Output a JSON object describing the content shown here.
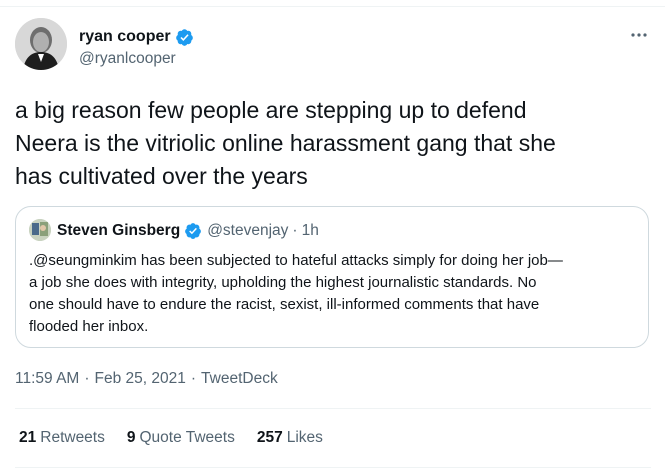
{
  "author": {
    "display_name": "ryan cooper",
    "handle": "@ryanlcooper",
    "verified_icon": "verified-badge-icon"
  },
  "tweet": {
    "text": "a big reason few people are stepping up to defend\nNeera is the vitriolic online harassment gang that she\nhas cultivated over the years"
  },
  "quote": {
    "display_name": "Steven Ginsberg",
    "handle": "@stevenjay",
    "separator": "·",
    "time": "1h",
    "text": ".@seungminkim has been subjected to hateful attacks simply for doing her job—\na job she does with integrity, upholding the highest journalistic standards. No\none should have to endure the racist, sexist, ill-informed comments that have\nflooded her inbox."
  },
  "meta": {
    "time": "11:59 AM",
    "dot1": "·",
    "date": "Feb 25, 2021",
    "dot2": "·",
    "source": "TweetDeck"
  },
  "stats": {
    "retweets_count": "21",
    "retweets_label": "Retweets",
    "quotes_count": "9",
    "quotes_label": "Quote Tweets",
    "likes_count": "257",
    "likes_label": "Likes"
  },
  "colors": {
    "verified": "#1d9bf0",
    "secondary_text": "#536471",
    "primary_text": "#0f1419",
    "border": "#cfd9de"
  }
}
